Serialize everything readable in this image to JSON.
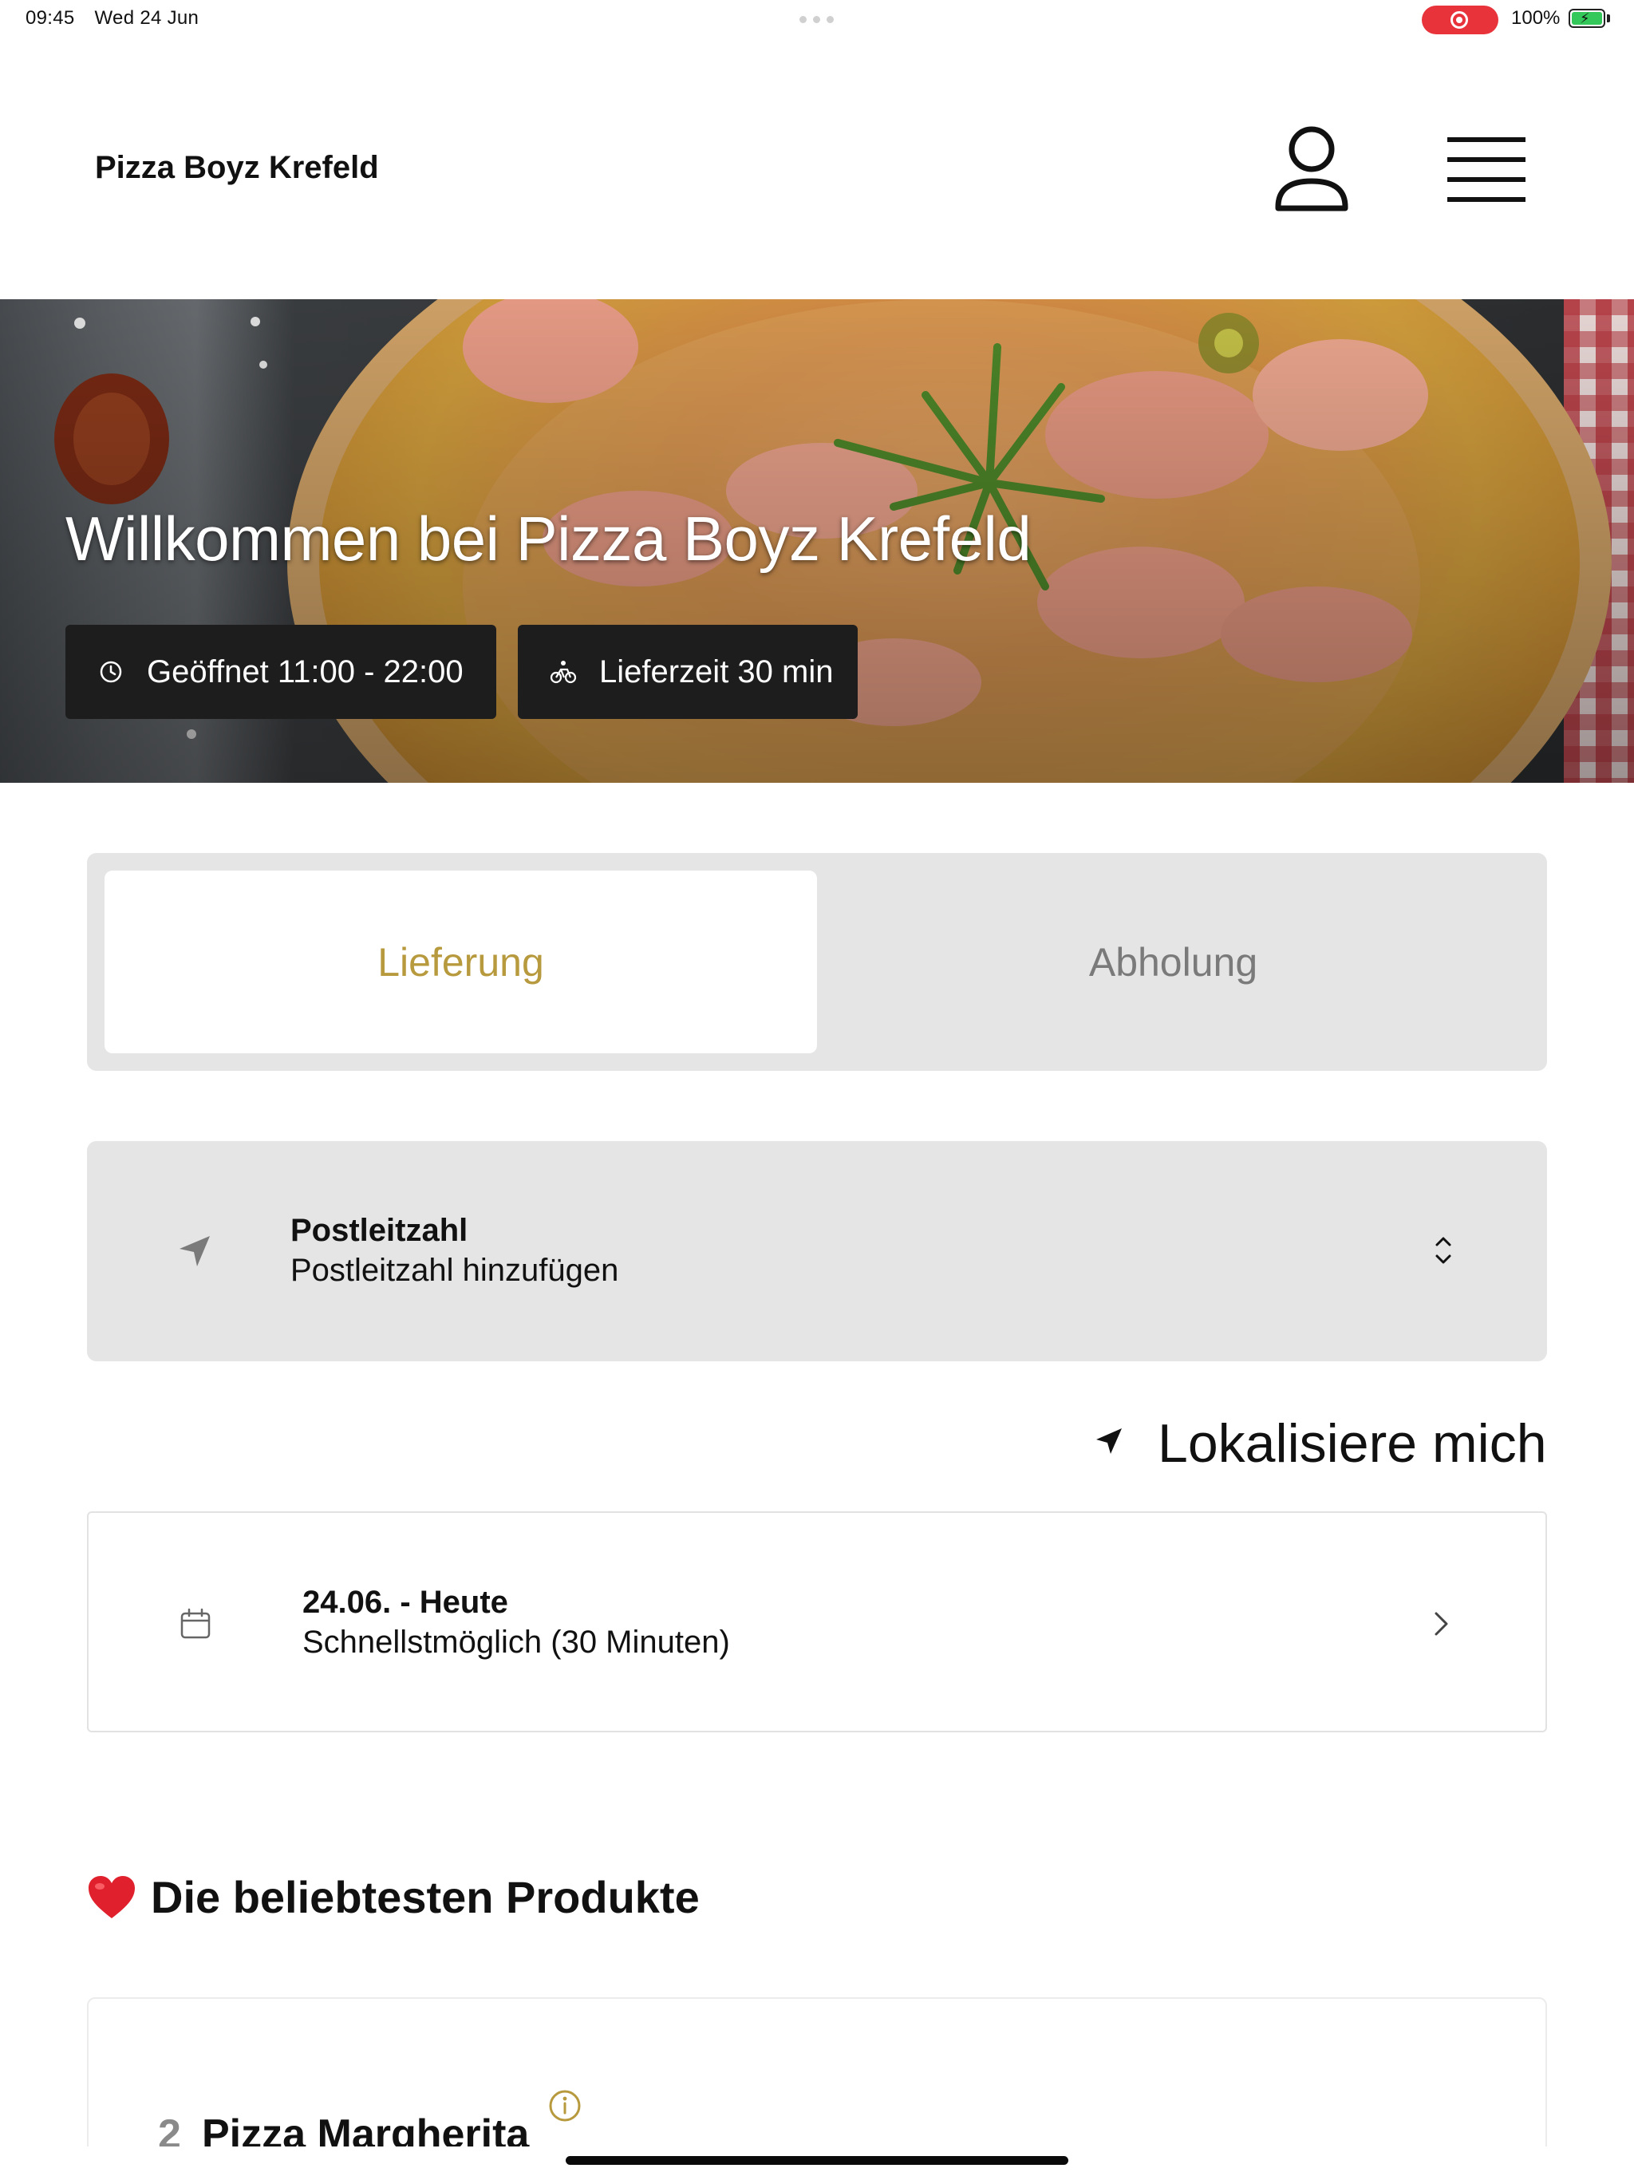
{
  "status_bar": {
    "time": "09:45",
    "date": "Wed 24 Jun",
    "battery": "100%"
  },
  "header": {
    "brand": "Pizza Boyz Krefeld",
    "profile_icon": "person-icon",
    "menu_icon": "hamburger-menu-icon"
  },
  "hero": {
    "title": "Willkommen bei Pizza Boyz Krefeld",
    "hours_label": "Geöffnet 11:00 - 22:00",
    "delivery_time_label": "Lieferzeit 30 min",
    "hours_icon": "clock-icon",
    "delivery_icon": "bicycle-icon"
  },
  "order_type": {
    "options": [
      "Lieferung",
      "Abholung"
    ],
    "selected": "Lieferung"
  },
  "postcode": {
    "label": "Postleitzahl",
    "placeholder": "Postleitzahl hinzufügen",
    "icon": "location-arrow-icon"
  },
  "locate": {
    "label": "Lokalisiere mich"
  },
  "schedule": {
    "title": "24.06. - Heute",
    "subtitle": "Schnellstmöglich (30 Minuten)",
    "icon": "calendar-icon"
  },
  "popular": {
    "heading": "Die beliebtesten Produkte",
    "products": [
      {
        "number": "2",
        "name": "Pizza Margherita"
      }
    ]
  },
  "colors": {
    "accent": "#b89a3e",
    "segment_bg": "#e5e5e5",
    "chip_bg": "#1d1d1d",
    "record_red": "#e8333b",
    "battery_green": "#34c759"
  }
}
